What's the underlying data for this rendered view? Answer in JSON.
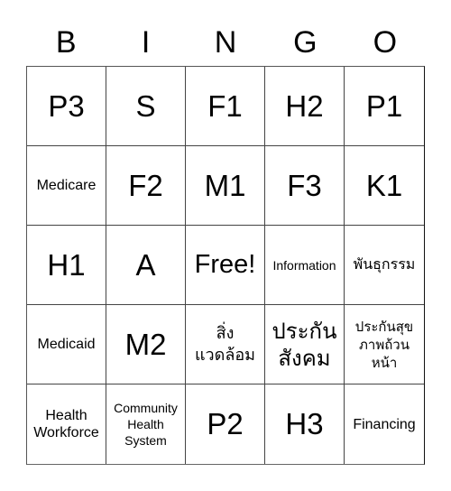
{
  "header": [
    "B",
    "I",
    "N",
    "G",
    "O"
  ],
  "cells": [
    {
      "text": "P3",
      "size": "big"
    },
    {
      "text": "S",
      "size": "big"
    },
    {
      "text": "F1",
      "size": "big"
    },
    {
      "text": "H2",
      "size": "big"
    },
    {
      "text": "P1",
      "size": "big"
    },
    {
      "text": "Medicare",
      "size": "small"
    },
    {
      "text": "F2",
      "size": "big"
    },
    {
      "text": "M1",
      "size": "big"
    },
    {
      "text": "F3",
      "size": "big"
    },
    {
      "text": "K1",
      "size": "big"
    },
    {
      "text": "H1",
      "size": "big"
    },
    {
      "text": "A",
      "size": "big"
    },
    {
      "text": "Free!",
      "size": "free"
    },
    {
      "text": "Information",
      "size": "tiny"
    },
    {
      "text": "พันธุกรรม",
      "size": "thai-one"
    },
    {
      "text": "Medicaid",
      "size": "small"
    },
    {
      "text": "M2",
      "size": "big"
    },
    {
      "text": "สิ่ง แวดล้อม",
      "size": "thai-med"
    },
    {
      "text": "ประกัน สังคม",
      "size": "thai-big"
    },
    {
      "text": "ประกันสุข ภาพถ้วน หน้า",
      "size": "thai-small"
    },
    {
      "text": "Health Workforce",
      "size": "small"
    },
    {
      "text": "Community Health System",
      "size": "tiny"
    },
    {
      "text": "P2",
      "size": "big"
    },
    {
      "text": "H3",
      "size": "big"
    },
    {
      "text": "Financing",
      "size": "small"
    }
  ]
}
